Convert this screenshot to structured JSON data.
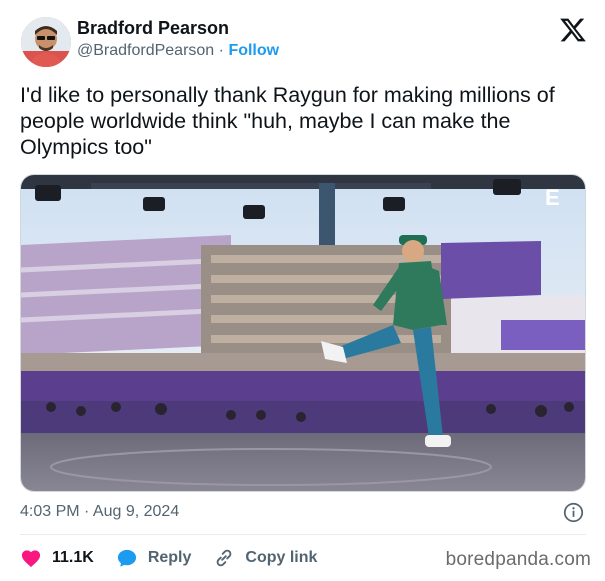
{
  "author": {
    "name": "Bradford Pearson",
    "handle": "@BradfordPearson",
    "separator": "·",
    "follow_label": "Follow"
  },
  "tweet": {
    "text": "I'd like to personally thank Raygun for making millions of people worldwide think \"huh, maybe I can make the Olympics too\"",
    "timestamp": "4:03 PM · Aug 9, 2024"
  },
  "media": {
    "description_icon": "broadcast-image",
    "channel_logo": "E"
  },
  "actions": {
    "like_count": "11.1K",
    "reply_label": "Reply",
    "copy_link_label": "Copy link"
  },
  "icons": {
    "brand": "x-logo-icon",
    "info": "info-icon",
    "like": "heart-icon",
    "reply": "speech-bubble-icon",
    "copy": "link-icon"
  },
  "colors": {
    "accent": "#1d9bf0",
    "like": "#f91880",
    "text": "#0f1419",
    "muted": "#536471"
  },
  "watermark": "boredpanda.com"
}
